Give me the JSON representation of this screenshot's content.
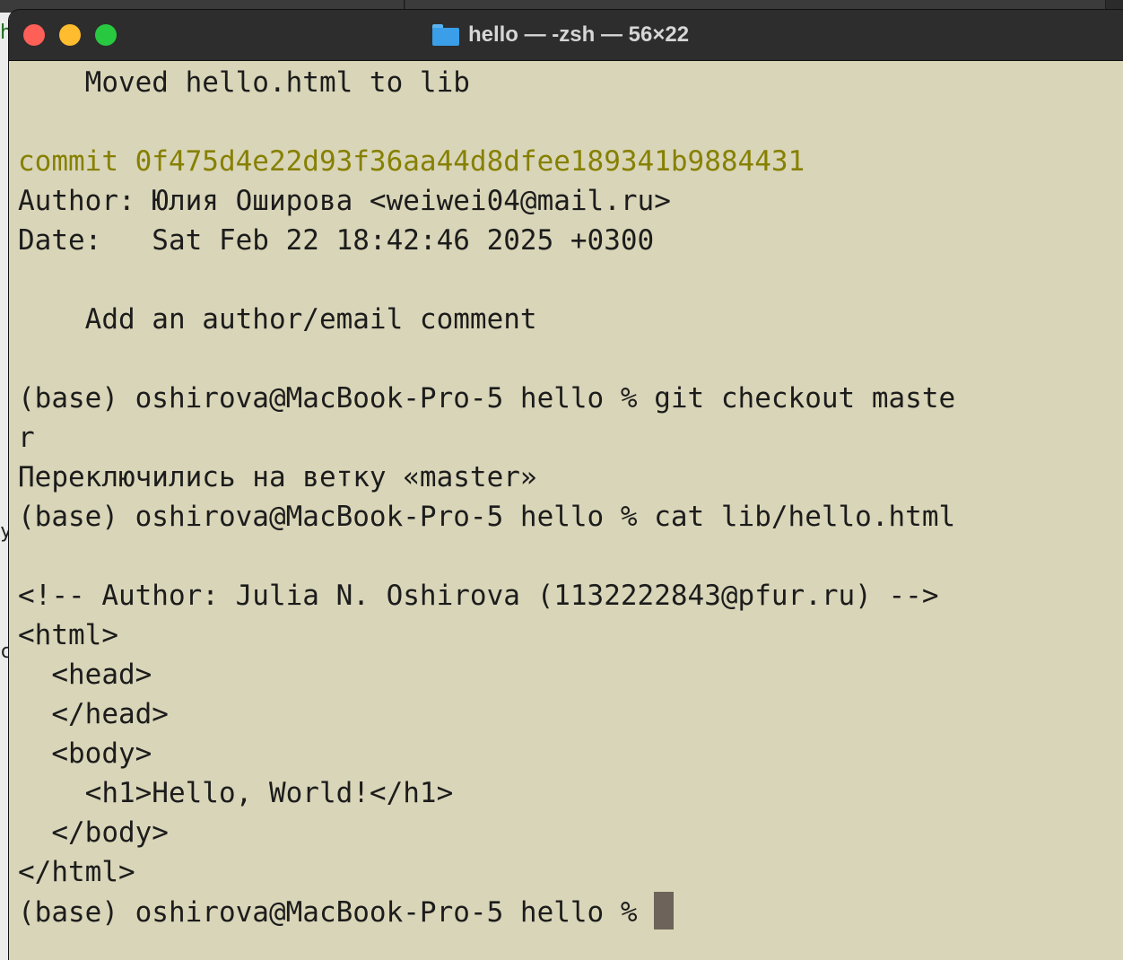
{
  "window": {
    "title": "hello — -zsh — 56×22",
    "folder_icon": "folder-icon"
  },
  "terminal": {
    "lines": [
      "    Moved hello.html to lib",
      "",
      "commit 0f475d4e22d93f36aa44d8dfee189341b9884431",
      "Author: Юлия Оширова <weiwei04@mail.ru>",
      "Date:   Sat Feb 22 18:42:46 2025 +0300",
      "",
      "    Add an author/email comment",
      "",
      "(base) oshirova@MacBook-Pro-5 hello % git checkout maste",
      "r",
      "Переключились на ветку «master»",
      "(base) oshirova@MacBook-Pro-5 hello % cat lib/hello.html",
      "",
      "<!-- Author: Julia N. Oshirova (1132222843@pfur.ru) -->",
      "<html>",
      "  <head>",
      "  </head>",
      "  <body>",
      "    <h1>Hello, World!</h1>",
      "  </body>",
      "</html>"
    ],
    "prompt": "(base) oshirova@MacBook-Pro-5 hello % "
  },
  "background": {
    "glyph_1": "h",
    "glyph_2": "y",
    "glyph_3": "c"
  },
  "colors": {
    "terminal_bg": "#d9d5b8",
    "text": "#1c1c1c",
    "commit_hash": "#868000",
    "titlebar": "#2d2d2d"
  }
}
